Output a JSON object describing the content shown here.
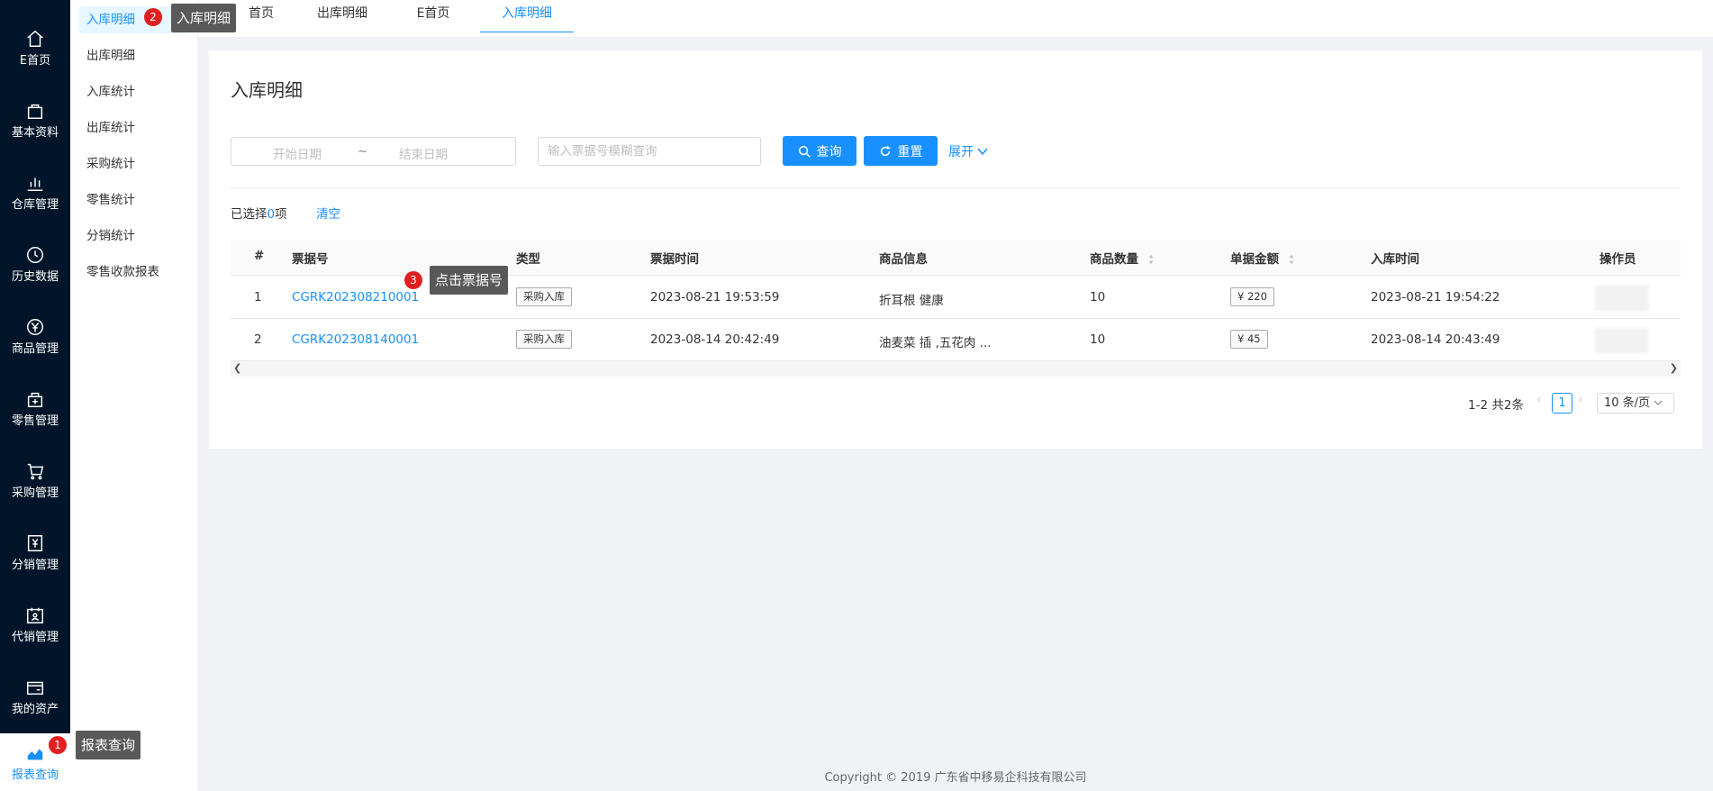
{
  "left_rail": [
    {
      "label": "E首页",
      "icon": "home-icon"
    },
    {
      "label": "基本资料",
      "icon": "bag-icon"
    },
    {
      "label": "仓库管理",
      "icon": "bar-chart-icon"
    },
    {
      "label": "历史数据",
      "icon": "clock-icon"
    },
    {
      "label": "商品管理",
      "icon": "yen-circle-icon"
    },
    {
      "label": "零售管理",
      "icon": "shop-bag-plus-icon"
    },
    {
      "label": "采购管理",
      "icon": "cart-icon"
    },
    {
      "label": "分销管理",
      "icon": "yen-doc-icon"
    },
    {
      "label": "代销管理",
      "icon": "calendar-person-icon"
    },
    {
      "label": "我的资产",
      "icon": "wallet-icon"
    },
    {
      "label": "报表查询",
      "icon": "area-chart-icon"
    }
  ],
  "submenu": [
    "入库明细",
    "出库明细",
    "入库统计",
    "出库统计",
    "采购统计",
    "零售统计",
    "分销统计",
    "零售收款报表"
  ],
  "tabs": [
    "首页",
    "出库明细",
    "E首页",
    "入库明细"
  ],
  "page_title": "入库明细",
  "search": {
    "start_placeholder": "开始日期",
    "separator": "~",
    "end_placeholder": "结束日期",
    "number_placeholder": "输入票据号模糊查询",
    "query_label": "查询",
    "reset_label": "重置",
    "expand_label": "展开"
  },
  "selection": {
    "prefix": "已选择",
    "count": "0",
    "suffix": "项",
    "clear_label": "清空"
  },
  "table": {
    "columns": [
      "#",
      "票据号",
      "类型",
      "票据时间",
      "商品信息",
      "商品数量",
      "单据金额",
      "入库时间",
      "操作员"
    ],
    "rows": [
      {
        "index": "1",
        "number": "CGRK202308210001",
        "type": "采购入库",
        "bill_time": "2023-08-21 19:53:59",
        "goods": "折耳根 健康",
        "qty": "10",
        "amount": "¥ 220",
        "in_time": "2023-08-21 19:54:22"
      },
      {
        "index": "2",
        "number": "CGRK202308140001",
        "type": "采购入库",
        "bill_time": "2023-08-14 20:42:49",
        "goods": "油麦菜 插 ,五花肉 ...",
        "qty": "10",
        "amount": "¥ 45",
        "in_time": "2023-08-14 20:43:49"
      }
    ]
  },
  "pagination": {
    "total_text": "1-2 共2条",
    "current_page": "1",
    "page_size": "10 条/页"
  },
  "footer": "Copyright © 2019 广东省中移易企科技有限公司",
  "guides": [
    {
      "number": "1",
      "text": "报表查询"
    },
    {
      "number": "2",
      "text": "入库明细"
    },
    {
      "number": "3",
      "text": "点击票据号"
    }
  ],
  "colors": {
    "primary": "#1890ff",
    "sidebar": "#001529",
    "badge": "#e02020",
    "tooltip": "#595959"
  }
}
